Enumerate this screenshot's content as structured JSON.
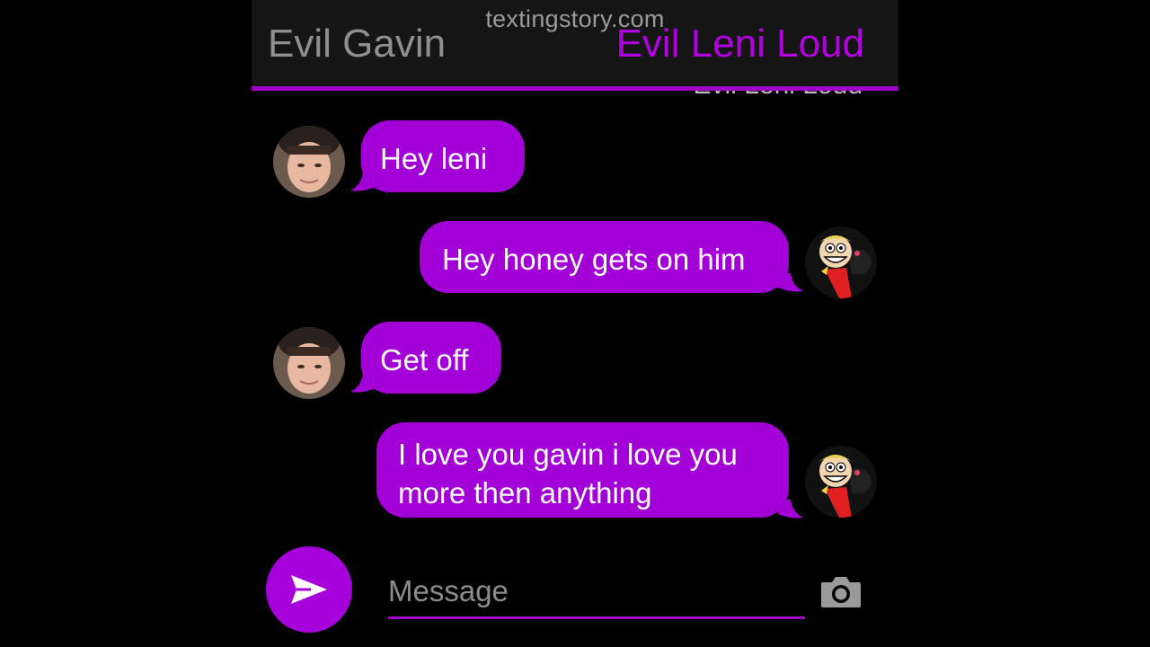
{
  "watermark": "textingstory.com",
  "header": {
    "left_contact": "Evil Gavin",
    "right_contact": "Evil Leni Loud",
    "accent_color": "#a000c8"
  },
  "overlap_name": "Evil Leni Loud",
  "messages": [
    {
      "sender": "Evil Gavin",
      "side": "left",
      "text": "Hey leni"
    },
    {
      "sender": "Evil Leni Loud",
      "side": "right",
      "text": "Hey honey gets on him"
    },
    {
      "sender": "Evil Gavin",
      "side": "left",
      "text": "Get off"
    },
    {
      "sender": "Evil Leni Loud",
      "side": "right",
      "text_line1": "I love you gavin i love you",
      "text_line2": "more then anything"
    }
  ],
  "composer": {
    "placeholder": "Message",
    "send_icon": "send-icon",
    "camera_icon": "camera-icon"
  },
  "colors": {
    "bubble": "#a200d6",
    "background": "#000000",
    "header_bg": "#151515"
  }
}
